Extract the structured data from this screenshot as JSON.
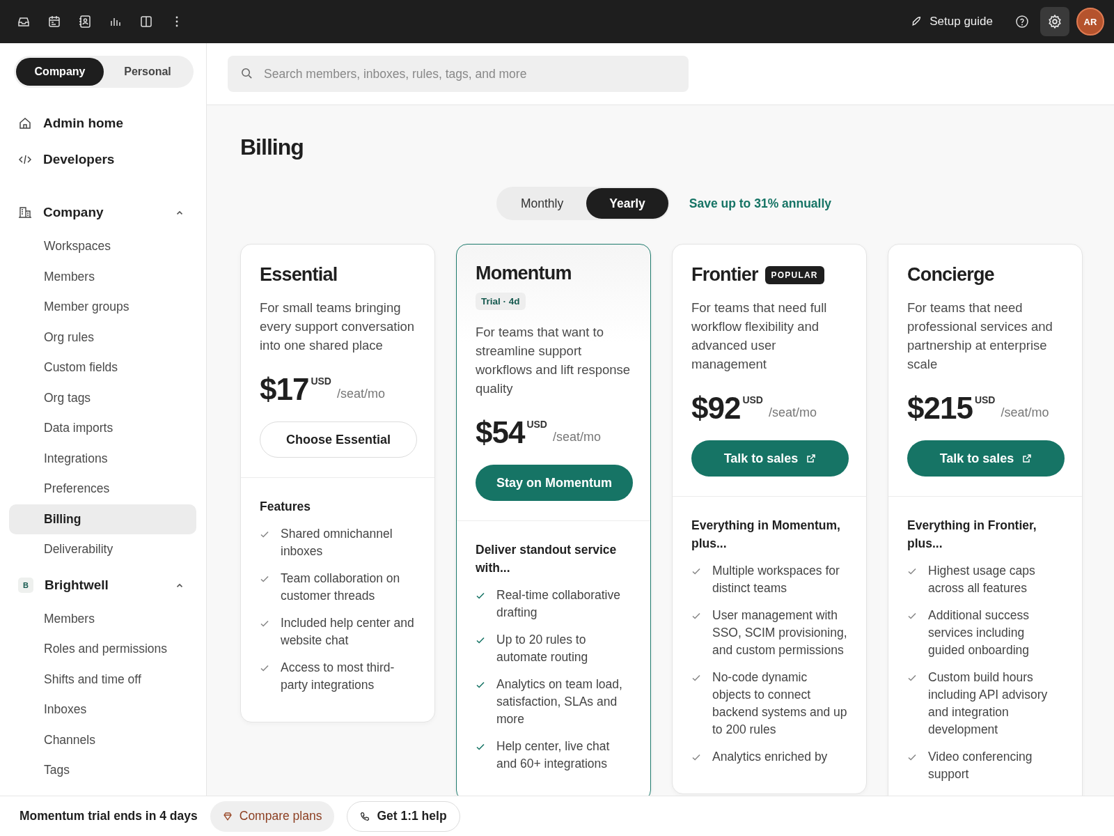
{
  "top_bar": {
    "setup_guide": "Setup guide",
    "avatar": "AR",
    "settings_active": true
  },
  "scope_tabs": [
    {
      "label": "Company",
      "selected": true
    },
    {
      "label": "Personal",
      "selected": false
    }
  ],
  "search": {
    "placeholder": "Search members, inboxes, rules, tags, and more"
  },
  "sidebar": {
    "links": [
      {
        "label": "Admin home",
        "kind": "home"
      },
      {
        "label": "Developers",
        "kind": "code"
      }
    ],
    "sections": [
      {
        "label": "Company",
        "kind": "building",
        "expanded": true,
        "items": [
          {
            "label": "Workspaces",
            "selected": false
          },
          {
            "label": "Members",
            "selected": false
          },
          {
            "label": "Member groups",
            "selected": false
          },
          {
            "label": "Org rules",
            "selected": false
          },
          {
            "label": "Custom fields",
            "selected": false
          },
          {
            "label": "Org tags",
            "selected": false
          },
          {
            "label": "Data imports",
            "selected": false
          },
          {
            "label": "Integrations",
            "selected": false
          },
          {
            "label": "Preferences",
            "selected": false
          },
          {
            "label": "Billing",
            "selected": true
          },
          {
            "label": "Deliverability",
            "selected": false
          }
        ]
      },
      {
        "label": "Brightwell",
        "kind": "badge",
        "badge": "B",
        "expanded": true,
        "items": [
          {
            "label": "Members",
            "selected": false
          },
          {
            "label": "Roles and permissions",
            "selected": false
          },
          {
            "label": "Shifts and time off",
            "selected": false
          },
          {
            "label": "Inboxes",
            "selected": false
          },
          {
            "label": "Channels",
            "selected": false
          },
          {
            "label": "Tags",
            "selected": false
          }
        ]
      }
    ]
  },
  "page_title": "Billing",
  "period_tabs": [
    {
      "label": "Monthly",
      "selected": false
    },
    {
      "label": "Yearly",
      "selected": true
    }
  ],
  "savings": "Save up to 31% annually",
  "plans": [
    {
      "name": "Essential",
      "selected": false,
      "description": "For small teams bringing every support conversation into one shared place",
      "price": "$17",
      "currency": "USD",
      "unit": "/seat/mo",
      "button": {
        "label": "Choose Essential",
        "kind": "outline",
        "external": false
      },
      "features_heading": "Features",
      "features": [
        "Shared omnichannel inboxes",
        "Team collaboration on customer threads",
        "Included help center and website chat",
        "Access to most third-party integrations"
      ]
    },
    {
      "name": "Momentum",
      "selected": true,
      "badge": {
        "label": "Trial · 4d",
        "kind": "trial"
      },
      "description": "For teams that want to streamline support workflows and lift response quality",
      "price": "$54",
      "currency": "USD",
      "unit": "/seat/mo",
      "button": {
        "label": "Stay on Momentum",
        "kind": "primary",
        "external": false
      },
      "features_heading": "Deliver standout service with...",
      "features": [
        "Real-time collaborative drafting",
        "Up to 20 rules to automate routing",
        "Analytics on team load, satisfaction, SLAs and more",
        "Help center, live chat and 60+ integrations"
      ]
    },
    {
      "name": "Frontier",
      "selected": false,
      "badge": {
        "label": "POPULAR",
        "kind": "popular"
      },
      "description": "For teams that need full workflow flexibility and advanced user management",
      "price": "$92",
      "currency": "USD",
      "unit": "/seat/mo",
      "button": {
        "label": "Talk to sales",
        "kind": "primary",
        "external": true
      },
      "features_heading": "Everything in Momentum, plus...",
      "features": [
        "Multiple workspaces for distinct teams",
        "User management with SSO, SCIM provisioning, and custom permissions",
        "No-code dynamic objects to connect backend systems and up to 200 rules",
        "Analytics enriched by"
      ]
    },
    {
      "name": "Concierge",
      "selected": false,
      "description": "For teams that need professional services and partnership at enterprise scale",
      "price": "$215",
      "currency": "USD",
      "unit": "/seat/mo",
      "button": {
        "label": "Talk to sales",
        "kind": "primary",
        "external": true
      },
      "features_heading": "Everything in Frontier, plus...",
      "features": [
        "Highest usage caps across all features",
        "Additional success services including guided onboarding",
        "Custom build hours including API advisory and integration development",
        "Video conferencing support"
      ]
    }
  ],
  "bottom_bar": {
    "trial_notice": "Momentum trial ends in 4 days",
    "compare_button": "Compare plans",
    "help_button": "Get 1:1 help"
  }
}
